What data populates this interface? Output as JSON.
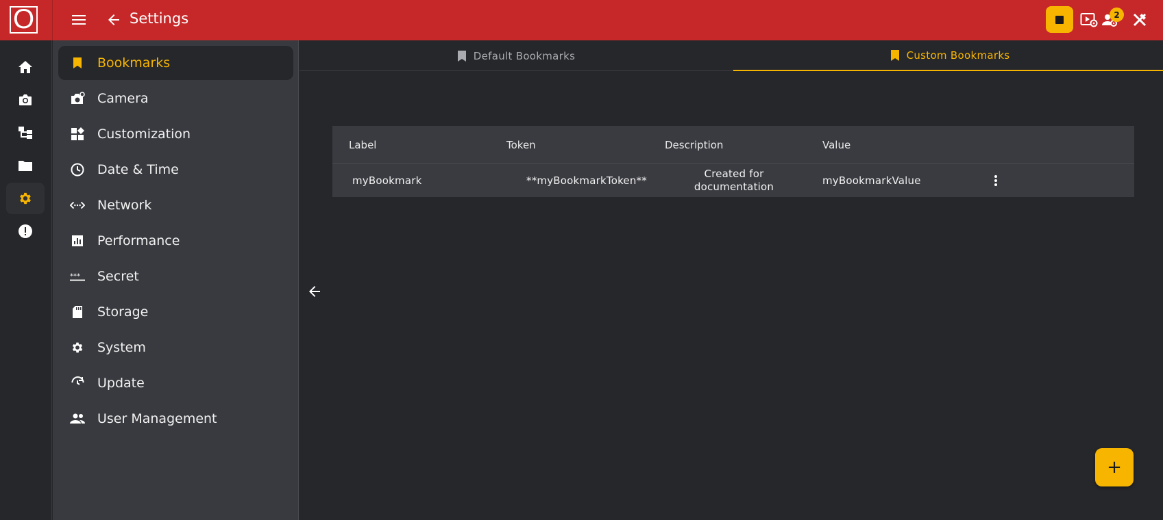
{
  "app": {
    "logo_letter": "O",
    "title": "Settings",
    "notification_count": "2",
    "accent_color": "#f8b500",
    "header_color": "#c62829"
  },
  "topbar": {
    "icons": [
      "menu-icon",
      "back-arrow-icon",
      "stop-icon",
      "video-settings-icon",
      "users-icon",
      "tools-icon"
    ]
  },
  "rail": {
    "items": [
      "home-icon",
      "camera-icon",
      "hierarchy-icon",
      "folder-icon",
      "gear-icon",
      "alert-icon"
    ],
    "active": "gear-icon"
  },
  "sidebar": {
    "items": [
      {
        "label": "Bookmarks",
        "icon": "bookmark-icon"
      },
      {
        "label": "Camera",
        "icon": "camera-settings-icon"
      },
      {
        "label": "Customization",
        "icon": "widgets-icon"
      },
      {
        "label": "Date & Time",
        "icon": "clock-icon"
      },
      {
        "label": "Network",
        "icon": "network-icon"
      },
      {
        "label": "Performance",
        "icon": "chart-icon"
      },
      {
        "label": "Secret",
        "icon": "password-icon"
      },
      {
        "label": "Storage",
        "icon": "sd-card-icon"
      },
      {
        "label": "System",
        "icon": "gear-icon"
      },
      {
        "label": "Update",
        "icon": "update-icon"
      },
      {
        "label": "User Management",
        "icon": "users-icon"
      }
    ],
    "active": "Bookmarks"
  },
  "tabs": [
    {
      "label": "Default Bookmarks",
      "active": false
    },
    {
      "label": "Custom Bookmarks",
      "active": true
    }
  ],
  "table": {
    "columns": [
      "Label",
      "Token",
      "Description",
      "Value"
    ],
    "rows": [
      {
        "label": "myBookmark",
        "token": "**myBookmarkToken**",
        "description_line1": "Created for",
        "description_line2": "documentation",
        "value": "myBookmarkValue"
      }
    ]
  },
  "fab": {
    "label": "+"
  }
}
